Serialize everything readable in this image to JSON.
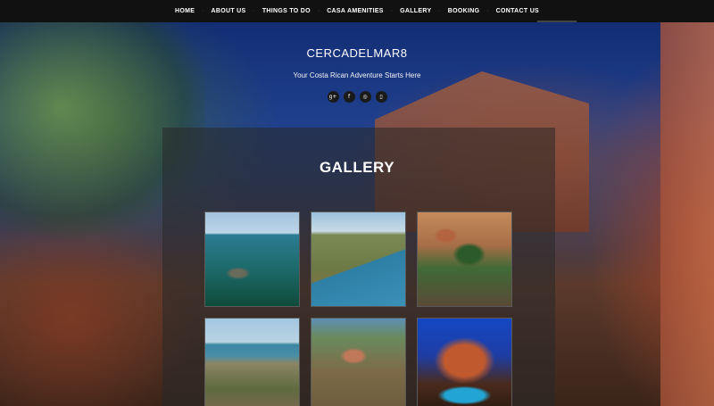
{
  "nav": {
    "items": [
      {
        "label": "HOME"
      },
      {
        "label": "ABOUT US"
      },
      {
        "label": "THINGS TO DO"
      },
      {
        "label": "CASA AMENITIES"
      },
      {
        "label": "GALLERY"
      },
      {
        "label": "BOOKING"
      },
      {
        "label": "CONTACT US"
      }
    ]
  },
  "header": {
    "site_title": "CERCADELMAR8",
    "tagline": "Your Costa Rican Adventure Starts Here",
    "social_icons": [
      "google-plus-icon",
      "facebook-icon",
      "instagram-icon",
      "mobile-icon"
    ],
    "social_glyphs": [
      "g+",
      "f",
      "◎",
      "▯"
    ]
  },
  "main": {
    "title": "GALLERY",
    "thumbnails": [
      {
        "name": "aerial-ocean-rocks"
      },
      {
        "name": "aerial-coastline-town"
      },
      {
        "name": "aerial-villas"
      },
      {
        "name": "aerial-beach-hills"
      },
      {
        "name": "aerial-resort-hillside"
      },
      {
        "name": "villa-pool-night"
      }
    ]
  },
  "colors": {
    "nav_bg": "#111111",
    "panel_bg": "rgba(40,40,40,0.55)",
    "text": "#ffffff"
  }
}
